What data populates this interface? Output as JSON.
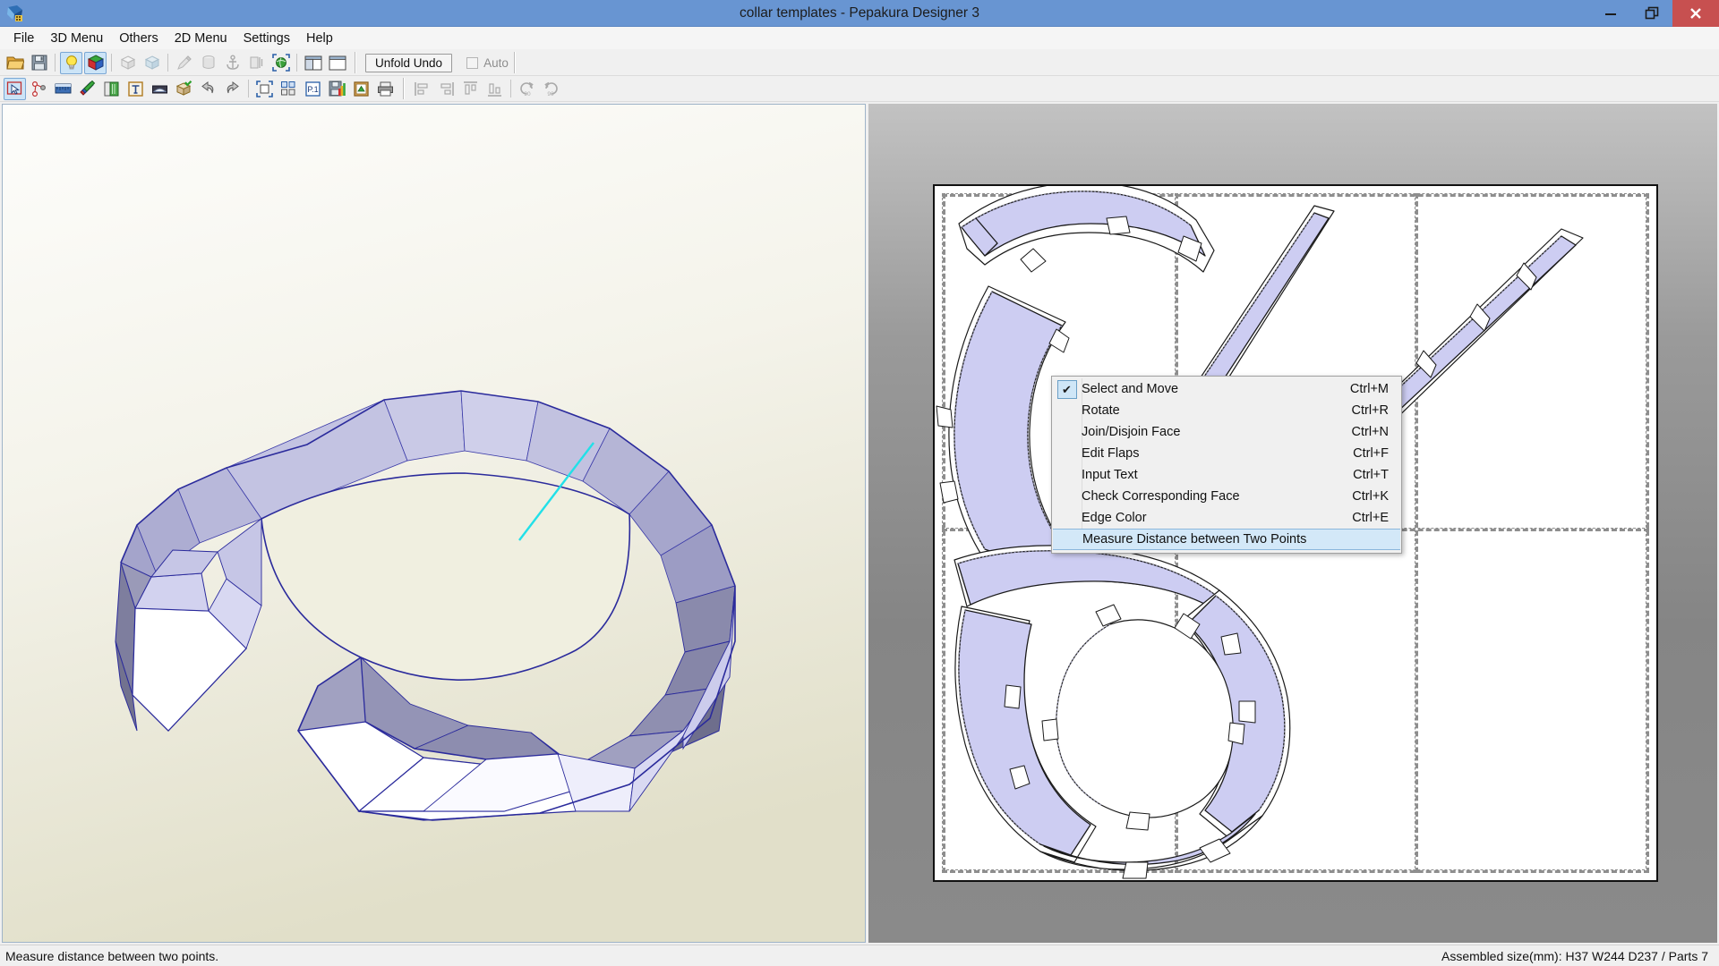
{
  "window": {
    "title": "collar templates - Pepakura Designer 3",
    "app_icon": "pepakura-app-icon",
    "controls": {
      "minimize": "minimize-icon",
      "maximize": "restore-icon",
      "close": "close-icon"
    },
    "titlebar_color": "#6895d2",
    "close_button_color": "#c75050"
  },
  "menubar": {
    "items": [
      {
        "label": "File",
        "name": "menu-file"
      },
      {
        "label": "3D Menu",
        "name": "menu-3d"
      },
      {
        "label": "Others",
        "name": "menu-others"
      },
      {
        "label": "2D Menu",
        "name": "menu-2d"
      },
      {
        "label": "Settings",
        "name": "menu-settings"
      },
      {
        "label": "Help",
        "name": "menu-help"
      }
    ]
  },
  "toolbar_top": {
    "buttons": [
      {
        "name": "open-file-icon",
        "icon": "folder-open",
        "state": "normal"
      },
      {
        "name": "save-file-icon",
        "icon": "floppy-disk",
        "state": "normal"
      },
      {
        "name": "toggle-light-icon",
        "icon": "light-bulb",
        "state": "active"
      },
      {
        "name": "toggle-texture-icon",
        "icon": "color-cube",
        "state": "active"
      },
      {
        "name": "flat-shading-icon",
        "icon": "white-cube",
        "state": "disabled"
      },
      {
        "name": "smooth-shading-icon",
        "icon": "blue-cube",
        "state": "disabled"
      },
      {
        "name": "pen-tool-icon",
        "icon": "pencil",
        "state": "disabled"
      },
      {
        "name": "cylinder-tool-icon",
        "icon": "cylinder",
        "state": "disabled"
      },
      {
        "name": "anchor-tool-icon",
        "icon": "anchor",
        "state": "disabled"
      },
      {
        "name": "mirror-tool-icon",
        "icon": "mirror",
        "state": "disabled"
      },
      {
        "name": "globe-select-icon",
        "icon": "globe-marquee",
        "state": "normal"
      },
      {
        "name": "split-view-horizontal-icon",
        "icon": "split-view-h",
        "state": "normal"
      },
      {
        "name": "single-view-icon",
        "icon": "single-view",
        "state": "normal"
      }
    ],
    "unfold_undo_label": "Unfold Undo",
    "auto_label": "Auto",
    "auto_checked": false
  },
  "toolbar_bottom": {
    "buttons": [
      {
        "name": "select-and-move-icon",
        "icon": "arrow-marquee",
        "state": "active"
      },
      {
        "name": "rotate-icon",
        "icon": "rotate-nodes",
        "state": "normal"
      },
      {
        "name": "measure-icon",
        "icon": "ruler",
        "state": "normal"
      },
      {
        "name": "edge-color-icon",
        "icon": "color-pens",
        "state": "normal"
      },
      {
        "name": "join-disjoin-icon",
        "icon": "green-book",
        "state": "normal"
      },
      {
        "name": "input-text-icon",
        "icon": "text-T",
        "state": "normal"
      },
      {
        "name": "edit-flaps-icon",
        "icon": "flap-edit",
        "state": "normal"
      },
      {
        "name": "check-corresponding-face-icon",
        "icon": "cube-check",
        "state": "normal"
      },
      {
        "name": "undo-icon",
        "icon": "undo-arrow",
        "state": "normal"
      },
      {
        "name": "redo-icon",
        "icon": "redo-arrow",
        "state": "normal"
      },
      {
        "name": "marquee-select-icon",
        "icon": "dashed-marquee",
        "state": "normal"
      },
      {
        "name": "layout-parts-icon",
        "icon": "layout-blocks",
        "state": "normal"
      },
      {
        "name": "page-one-icon",
        "icon": "page-p1",
        "state": "normal"
      },
      {
        "name": "export-icon",
        "icon": "floppy-export",
        "state": "normal"
      },
      {
        "name": "clipboard-icon",
        "icon": "clipboard-green",
        "state": "normal"
      },
      {
        "name": "print-icon",
        "icon": "printer",
        "state": "normal"
      },
      {
        "name": "align-left-icon",
        "icon": "align-left",
        "state": "disabled"
      },
      {
        "name": "align-right-icon",
        "icon": "align-right",
        "state": "disabled"
      },
      {
        "name": "align-top-icon",
        "icon": "align-top",
        "state": "disabled"
      },
      {
        "name": "align-bottom-icon",
        "icon": "align-bottom",
        "state": "disabled"
      },
      {
        "name": "rotate-ccw-90-icon",
        "icon": "rotate-90-ccw",
        "state": "disabled"
      },
      {
        "name": "rotate-cw-90-icon",
        "icon": "rotate-90-cw",
        "state": "disabled"
      }
    ]
  },
  "panel_3d": {
    "name": "3d-model-view",
    "model_description": "collar ring 3d model",
    "face_fill_light": "#ccccee",
    "face_fill_mid": "#a8a8c8",
    "face_fill_dark": "#8a8aa8",
    "edge_color": "#2b2b9c",
    "highlight_edge_color": "#22e0e8",
    "background_top": "#fdfdfb",
    "background_bottom": "#e3e1cc"
  },
  "panel_2d": {
    "name": "2d-unfold-view",
    "sheet_background": "#ffffff",
    "part_fill": "#cdcdf2",
    "part_outline": "#1a1a1a",
    "fold_line_color": "#8f8fb0",
    "page_guide_color": "#8e8e8e",
    "page_border_color": "#111111",
    "canvas_background": "#8a8a8a"
  },
  "context_menu": {
    "name": "2d-tool-context-menu",
    "items": [
      {
        "label": "Select and Move",
        "accel": "Ctrl+M",
        "checked": true,
        "highlighted": false,
        "name": "ctx-select-and-move"
      },
      {
        "label": "Rotate",
        "accel": "Ctrl+R",
        "checked": false,
        "highlighted": false,
        "name": "ctx-rotate"
      },
      {
        "label": "Join/Disjoin Face",
        "accel": "Ctrl+N",
        "checked": false,
        "highlighted": false,
        "name": "ctx-join-disjoin-face"
      },
      {
        "label": "Edit Flaps",
        "accel": "Ctrl+F",
        "checked": false,
        "highlighted": false,
        "name": "ctx-edit-flaps"
      },
      {
        "label": "Input Text",
        "accel": "Ctrl+T",
        "checked": false,
        "highlighted": false,
        "name": "ctx-input-text"
      },
      {
        "label": "Check Corresponding Face",
        "accel": "Ctrl+K",
        "checked": false,
        "highlighted": false,
        "name": "ctx-check-corresponding-face"
      },
      {
        "label": "Edge Color",
        "accel": "Ctrl+E",
        "checked": false,
        "highlighted": false,
        "name": "ctx-edge-color"
      },
      {
        "label": "Measure Distance between Two Points",
        "accel": "",
        "checked": false,
        "highlighted": true,
        "name": "ctx-measure-distance"
      }
    ],
    "check_glyph": "✔",
    "highlight_color": "#d3e8f8"
  },
  "statusbar": {
    "hint": "Measure distance between two points.",
    "assembled_size": "Assembled size(mm): H37 W244 D237 / Parts 7"
  }
}
